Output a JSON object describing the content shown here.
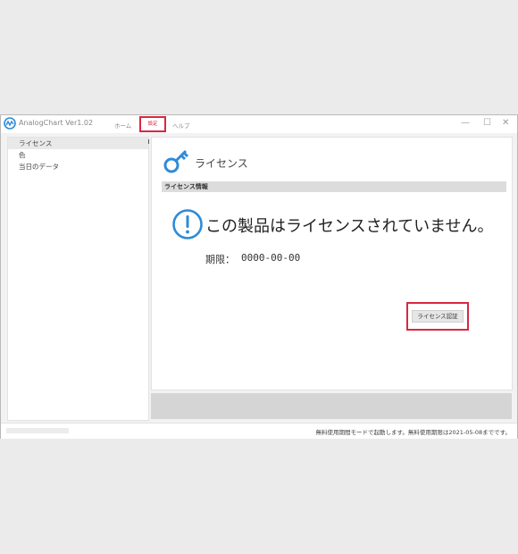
{
  "app": {
    "title": "AnalogChart Ver1.02"
  },
  "menu": {
    "home": "ホーム",
    "settings": "設定",
    "help": "ヘルプ"
  },
  "window_controls": {
    "minimize": "—",
    "maximize": "☐",
    "close": "✕"
  },
  "sidebar": {
    "items": [
      {
        "label": "ライセンス",
        "selected": true
      },
      {
        "label": "色",
        "selected": false
      },
      {
        "label": "当日のデータ",
        "selected": false
      }
    ]
  },
  "license": {
    "title": "ライセンス",
    "section_header": "ライセンス情報",
    "status_message": "この製品はライセンスされていません。",
    "expiry_label": "期限：",
    "expiry_value": "0000-00-00",
    "auth_button": "ライセンス認証"
  },
  "statusbar": {
    "message": "無料使用期間モードで起動します。無料使用期限は2021-05-08までです。"
  },
  "colors": {
    "highlight": "#d9283f",
    "accent": "#2e8bd8"
  },
  "icons": {
    "app_logo": "analogchart-logo-icon",
    "license": "key-icon",
    "status": "info-circle-icon"
  }
}
